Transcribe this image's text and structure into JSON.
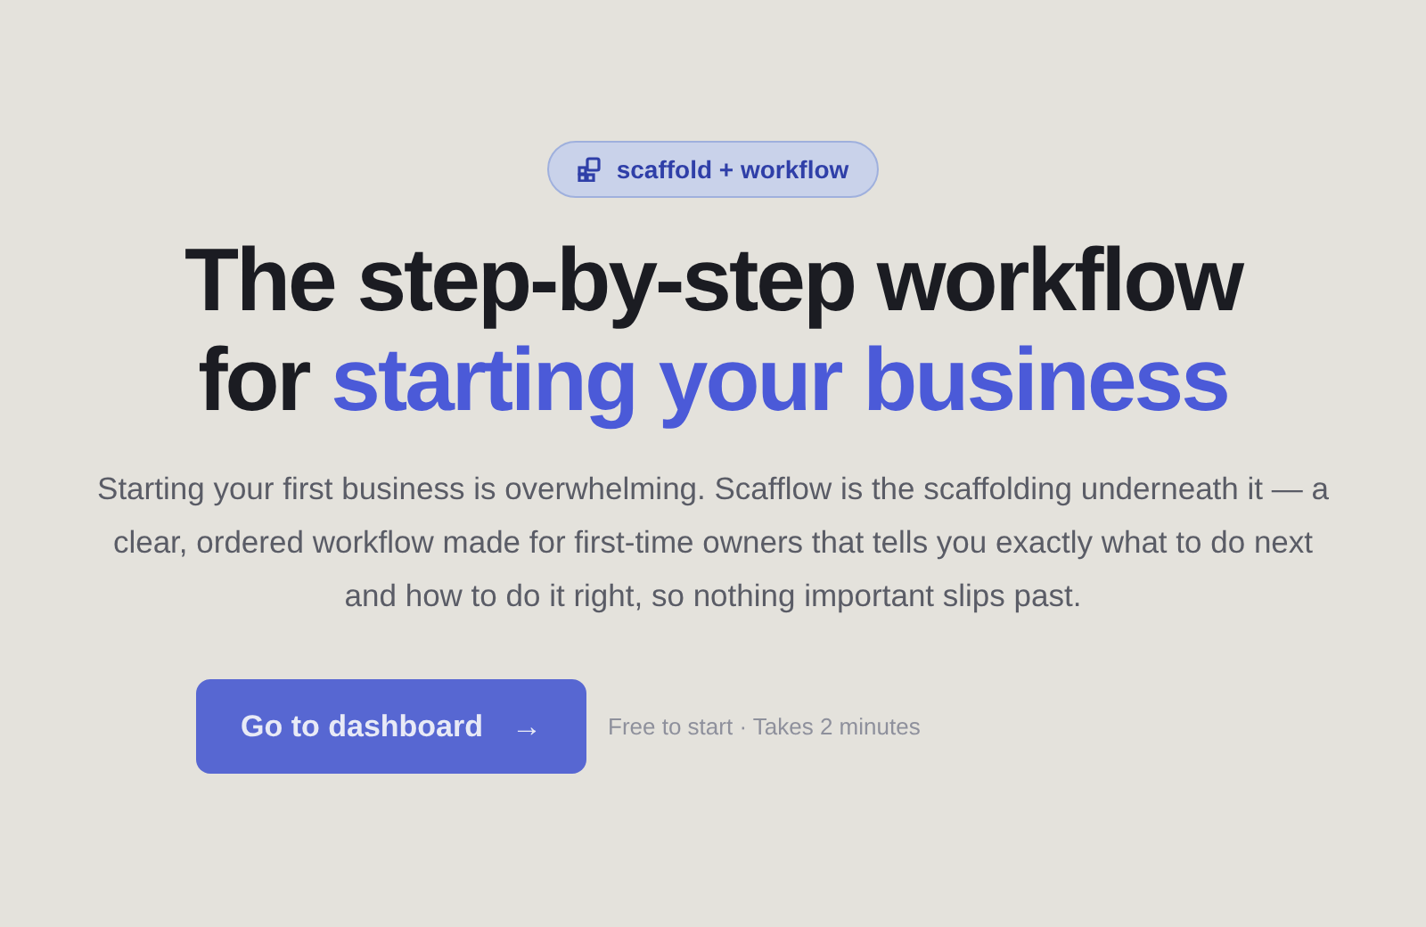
{
  "badge": {
    "label": "scaffold + workflow"
  },
  "headline": {
    "line_1": "The step-by-step workflow",
    "line_2_lead": "for",
    "line_2_accent": "starting your business"
  },
  "description": "Starting your first business is overwhelming. Scafflow is the scaffolding underneath it — a clear, ordered workflow made for first-time owners that tells you exactly what to do next and how to do it right, so nothing important slips past.",
  "cta": {
    "label": "Go to dashboard",
    "arrow": "→",
    "note": "Free to start · Takes 2 minutes"
  }
}
